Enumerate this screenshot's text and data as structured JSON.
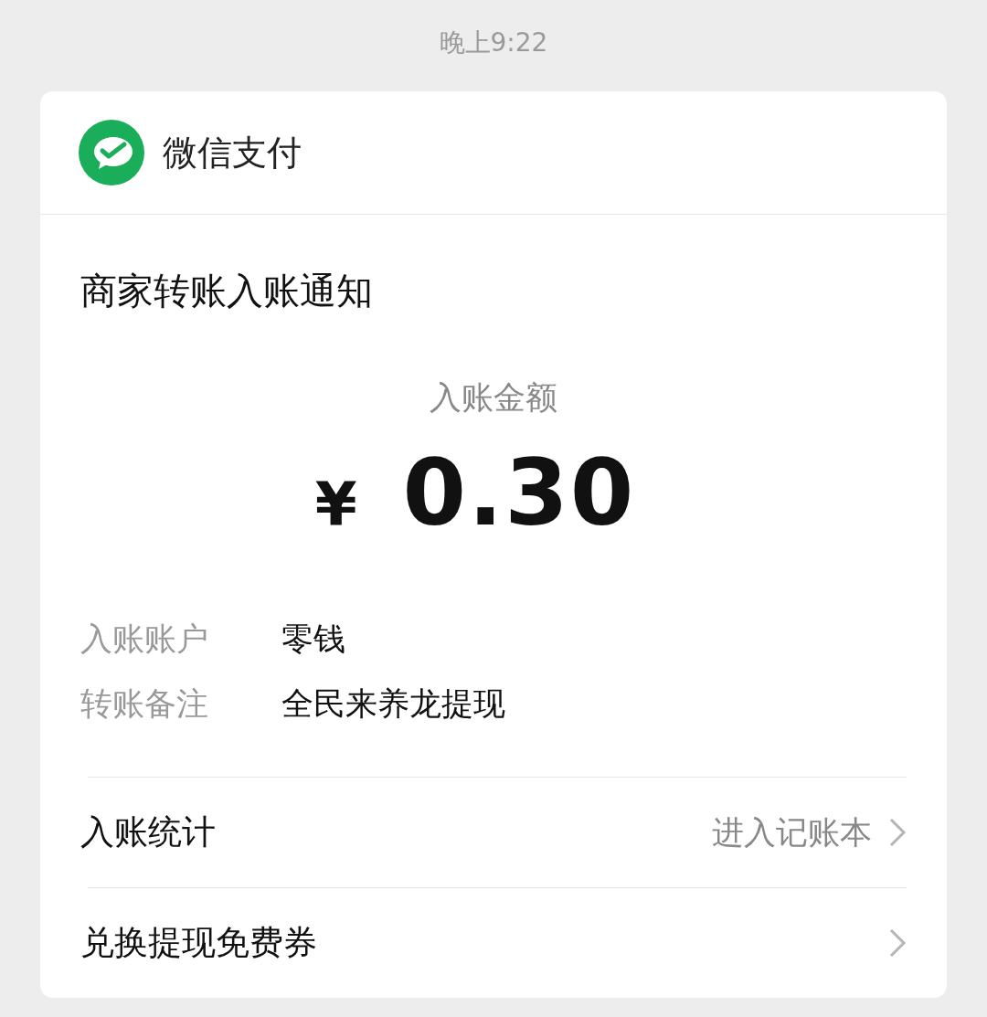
{
  "time": "晚上9:22",
  "app": {
    "name": "微信支付"
  },
  "notice": {
    "title": "商家转账入账通知"
  },
  "amount": {
    "label": "入账金额",
    "currency": "¥",
    "value": "0.30"
  },
  "details": [
    {
      "label": "入账账户",
      "value": "零钱"
    },
    {
      "label": "转账备注",
      "value": "全民来养龙提现"
    }
  ],
  "links": [
    {
      "label": "入账统计",
      "value": "进入记账本"
    },
    {
      "label": "兑换提现免费券"
    }
  ]
}
